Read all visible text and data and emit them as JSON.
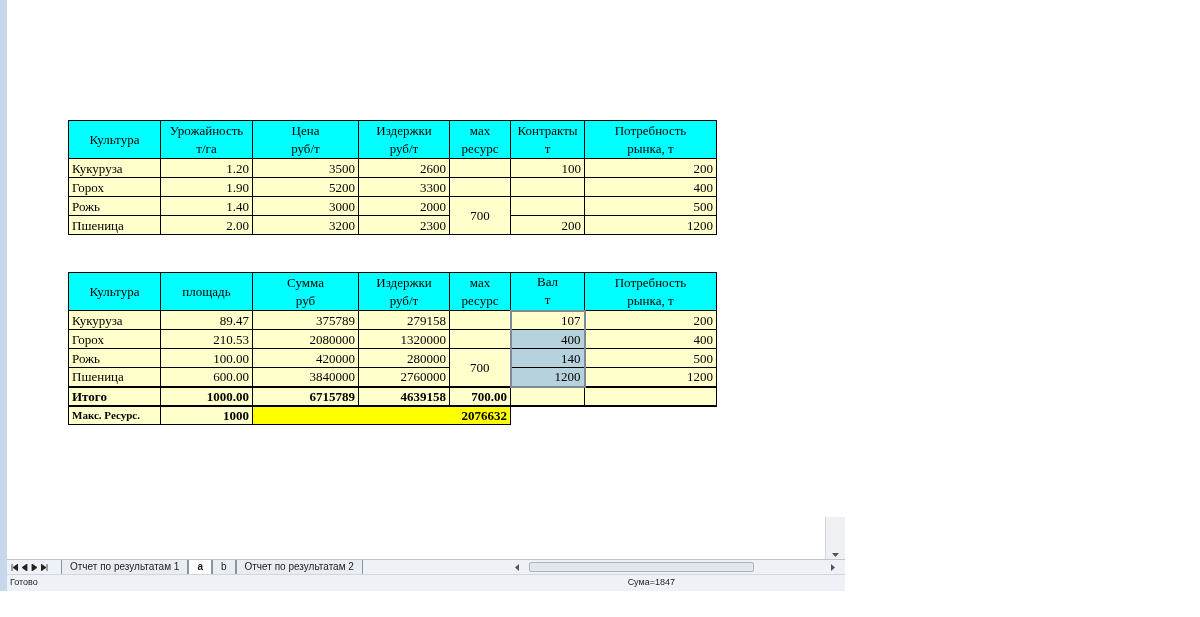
{
  "table_1": {
    "header": [
      [
        "Культура"
      ],
      [
        "Урожайность",
        "т/га"
      ],
      [
        "Цена",
        "руб/т"
      ],
      [
        "Издержки",
        "руб/т"
      ],
      [
        "мах",
        "ресурс"
      ],
      [
        "Контракты",
        "т"
      ],
      [
        "Потребность",
        "рынка, т"
      ]
    ],
    "rows": [
      {
        "cells": [
          "Кукуруза",
          "1.20",
          "3500",
          "2600"
        ],
        "contract": "100",
        "demand": "200"
      },
      {
        "cells": [
          "Горох",
          "1.90",
          "5200",
          "3300"
        ],
        "demand": "400"
      },
      {
        "cells": [
          "Рожь",
          "1.40",
          "3000",
          "2000"
        ],
        "demand": "500"
      },
      {
        "cells": [
          "Пшеница",
          "2.00",
          "3200",
          "2300"
        ],
        "contract": "200",
        "demand": "1200"
      }
    ],
    "resource": "700"
  },
  "table_2": {
    "header": [
      [
        "Культура"
      ],
      [
        "площадь"
      ],
      [
        "Сумма",
        "руб"
      ],
      [
        "Издержки",
        "руб/т"
      ],
      [
        "мах",
        "ресурс"
      ],
      [
        "Вал",
        "т"
      ],
      [
        "Потребность",
        "рынка, т"
      ]
    ],
    "rows": [
      {
        "cells": [
          "Кукуруза",
          "89.47",
          "375789",
          "279158"
        ],
        "val": "107",
        "highlighted": false,
        "demand": "200"
      },
      {
        "cells": [
          "Горох",
          "210.53",
          "2080000",
          "1320000"
        ],
        "val": "400",
        "highlighted": true,
        "demand": "400"
      },
      {
        "cells": [
          "Рожь",
          "100.00",
          "420000",
          "280000"
        ],
        "val": "140",
        "highlighted": true,
        "demand": "500"
      },
      {
        "cells": [
          "Пшеница",
          "600.00",
          "3840000",
          "2760000"
        ],
        "val": "1200",
        "highlighted": true,
        "demand": "1200"
      }
    ],
    "resource": "700",
    "total": [
      "Итого",
      "1000.00",
      "6715789",
      "4639158",
      "700.00"
    ],
    "max_row": {
      "label": "Макс. Ресурс.",
      "area": "1000",
      "objective": "2076632"
    }
  },
  "sheet_tabs": [
    {
      "label": "Отчет по результатам 1",
      "selected": false
    },
    {
      "label": "a",
      "selected": true
    },
    {
      "label": "b",
      "selected": false
    },
    {
      "label": "Отчет по результатам 2",
      "selected": false
    }
  ],
  "status_bar": {
    "status": "Готово",
    "sum": "Сума=1847"
  }
}
